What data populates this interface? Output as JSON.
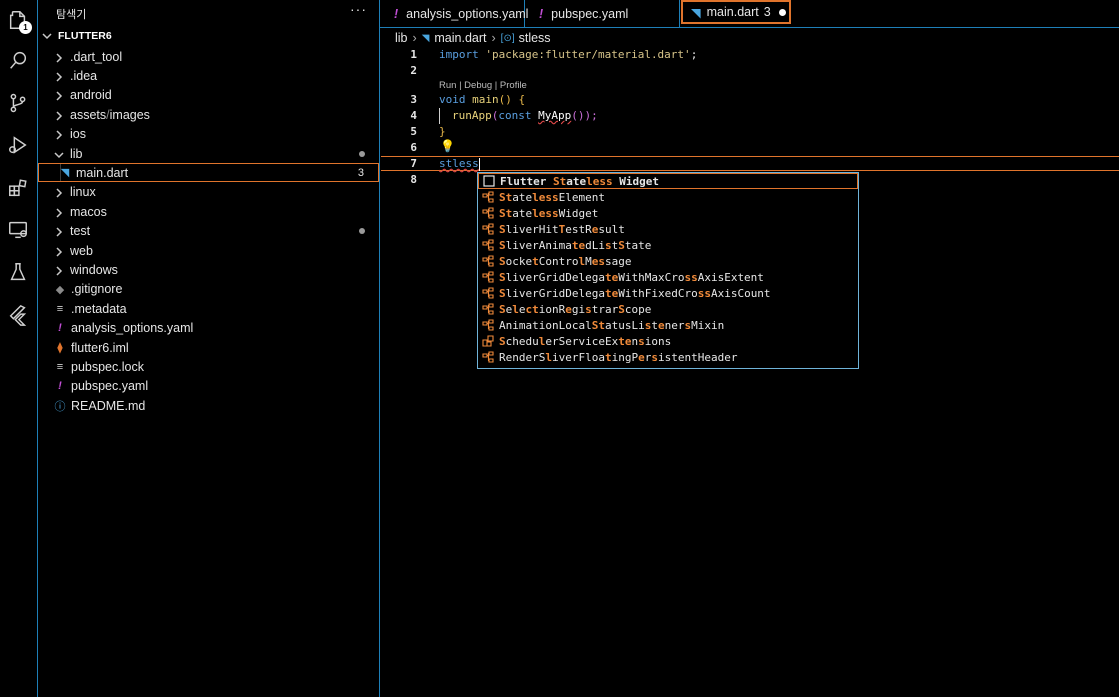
{
  "activity_bar": {
    "explorer_badge": "1",
    "icons": [
      "explorer-icon",
      "search-icon",
      "source-control-icon",
      "run-debug-icon",
      "extensions-icon",
      "remote-explorer-icon",
      "testing-icon",
      "flutter-icon"
    ]
  },
  "sidebar": {
    "title": "탐색기",
    "more_label": "···",
    "root": "FLUTTER6",
    "items": [
      {
        "label": ".dart_tool",
        "type": "folder"
      },
      {
        "label": ".idea",
        "type": "folder"
      },
      {
        "label": "android",
        "type": "folder"
      },
      {
        "label": "assets",
        "label2": "images",
        "type": "folder"
      },
      {
        "label": "ios",
        "type": "folder"
      },
      {
        "label": "lib",
        "type": "folder-open",
        "dot": true
      },
      {
        "label": "main.dart",
        "type": "dart",
        "count": "3"
      },
      {
        "label": "linux",
        "type": "folder"
      },
      {
        "label": "macos",
        "type": "folder"
      },
      {
        "label": "test",
        "type": "folder",
        "dot": true
      },
      {
        "label": "web",
        "type": "folder"
      },
      {
        "label": "windows",
        "type": "folder"
      },
      {
        "label": ".gitignore",
        "type": "git"
      },
      {
        "label": ".metadata",
        "type": "lines"
      },
      {
        "label": "analysis_options.yaml",
        "type": "yaml"
      },
      {
        "label": "flutter6.iml",
        "type": "rss"
      },
      {
        "label": "pubspec.lock",
        "type": "lines"
      },
      {
        "label": "pubspec.yaml",
        "type": "yaml"
      },
      {
        "label": "README.md",
        "type": "info"
      }
    ]
  },
  "tabs": [
    {
      "label": "analysis_options.yaml",
      "icon": "!"
    },
    {
      "label": "pubspec.yaml",
      "icon": "!"
    },
    {
      "label": "main.dart",
      "count": "3",
      "dirty": true
    }
  ],
  "breadcrumb": {
    "folder": "lib",
    "file": "main.dart",
    "symbol": "stless",
    "symbol_icon": "[⊙]"
  },
  "editor": {
    "line_numbers": [
      "1",
      "2",
      "3",
      "4",
      "5",
      "6",
      "7",
      "8"
    ],
    "line1": {
      "kw": "import",
      "str": "'package:flutter/material.dart'",
      "end": ";"
    },
    "codelens": "Run | Debug | Profile",
    "line3": {
      "kw": "void",
      "fn": "main",
      "paren": "()",
      "brace": "{"
    },
    "line4": {
      "fn": "runApp",
      "open": "(",
      "kw": "const",
      "cls": "MyApp",
      "close": "());"
    },
    "line5": {
      "brace": "}"
    },
    "line7": {
      "text": "stless"
    }
  },
  "suggestions": [
    {
      "parts": [
        [
          "Flutter ",
          0
        ],
        [
          "St",
          1
        ],
        [
          "ate",
          0
        ],
        [
          "less",
          1
        ],
        [
          " Widget",
          0
        ]
      ],
      "icon": "snippet-icon",
      "bold": true
    },
    {
      "parts": [
        [
          "St",
          1
        ],
        [
          "ate",
          0
        ],
        [
          "less",
          1
        ],
        [
          "Element",
          0
        ]
      ],
      "icon": "class-icon"
    },
    {
      "parts": [
        [
          "St",
          1
        ],
        [
          "ate",
          0
        ],
        [
          "less",
          1
        ],
        [
          "Widget",
          0
        ]
      ],
      "icon": "class-icon"
    },
    {
      "parts": [
        [
          "S",
          1
        ],
        [
          "liverHit",
          0
        ],
        [
          "T",
          1
        ],
        [
          "estR",
          0
        ],
        [
          "e",
          1
        ],
        [
          "sult",
          0
        ]
      ],
      "icon": "class-icon"
    },
    {
      "parts": [
        [
          "S",
          1
        ],
        [
          "liverAnima",
          0
        ],
        [
          "te",
          1
        ],
        [
          "dLi",
          0
        ],
        [
          "s",
          1
        ],
        [
          "t",
          0
        ],
        [
          "S",
          1
        ],
        [
          "tate",
          0
        ]
      ],
      "icon": "class-icon"
    },
    {
      "parts": [
        [
          "S",
          1
        ],
        [
          "ocke",
          0
        ],
        [
          "t",
          1
        ],
        [
          "Contro",
          0
        ],
        [
          "l",
          1
        ],
        [
          "M",
          0
        ],
        [
          "es",
          1
        ],
        [
          "sage",
          0
        ]
      ],
      "icon": "class-icon"
    },
    {
      "parts": [
        [
          "S",
          1
        ],
        [
          "liverGridDelega",
          0
        ],
        [
          "te",
          1
        ],
        [
          "WithMaxCro",
          0
        ],
        [
          "ss",
          1
        ],
        [
          "AxisExtent",
          0
        ]
      ],
      "icon": "class-icon"
    },
    {
      "parts": [
        [
          "S",
          1
        ],
        [
          "liverGridDelega",
          0
        ],
        [
          "te",
          1
        ],
        [
          "WithFixedCro",
          0
        ],
        [
          "ss",
          1
        ],
        [
          "AxisCount",
          0
        ]
      ],
      "icon": "class-icon"
    },
    {
      "parts": [
        [
          "S",
          1
        ],
        [
          "e",
          0
        ],
        [
          "l",
          1
        ],
        [
          "e",
          0
        ],
        [
          "ct",
          1
        ],
        [
          "ionR",
          0
        ],
        [
          "e",
          1
        ],
        [
          "gi",
          0
        ],
        [
          "s",
          1
        ],
        [
          "trar",
          0
        ],
        [
          "S",
          1
        ],
        [
          "cope",
          0
        ]
      ],
      "icon": "class-icon"
    },
    {
      "parts": [
        [
          "AnimationLocal",
          0
        ],
        [
          "St",
          1
        ],
        [
          "atusLi",
          0
        ],
        [
          "s",
          1
        ],
        [
          "t",
          0
        ],
        [
          "e",
          1
        ],
        [
          "ner",
          0
        ],
        [
          "s",
          1
        ],
        [
          "Mixin",
          0
        ]
      ],
      "icon": "class-icon"
    },
    {
      "parts": [
        [
          "S",
          1
        ],
        [
          "chedu",
          0
        ],
        [
          "l",
          1
        ],
        [
          "erServiceEx",
          0
        ],
        [
          "te",
          1
        ],
        [
          "n",
          0
        ],
        [
          "s",
          1
        ],
        [
          "ions",
          0
        ]
      ],
      "icon": "extension-icon"
    },
    {
      "parts": [
        [
          "RenderS",
          0
        ],
        [
          "l",
          1
        ],
        [
          "iverFloa",
          0
        ],
        [
          "t",
          1
        ],
        [
          "ingP",
          0
        ],
        [
          "e",
          1
        ],
        [
          "r",
          0
        ],
        [
          "s",
          1
        ],
        [
          "istentHeader",
          0
        ]
      ],
      "icon": "class-icon"
    }
  ],
  "colors": {
    "accent": "#e0742c",
    "border": "#1e7fb8",
    "highlight": "#f08a3a",
    "dart": "#4aa6df",
    "yaml": "#c24fd6"
  }
}
